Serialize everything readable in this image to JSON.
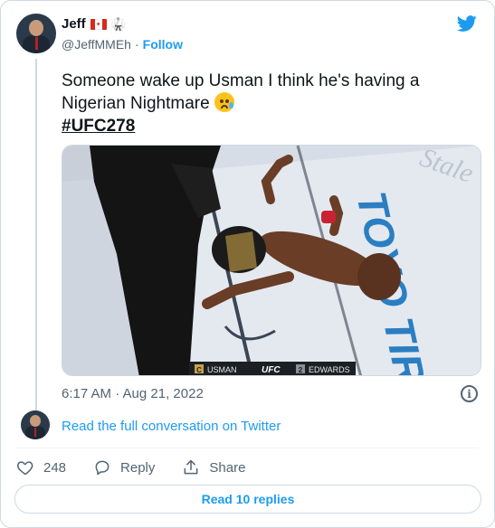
{
  "author": {
    "name": "Jeff",
    "handle": "@JeffMMEh",
    "separator": "·",
    "follow_label": "Follow",
    "flag_icon": "canada-flag-icon",
    "badge_icon": "karate-gi-icon"
  },
  "tweet": {
    "text": "Someone wake up Usman I think he's having a Nigerian Nightmare",
    "emoji_icon": "crying-face-emoji",
    "hashtag": "#UFC278"
  },
  "media": {
    "scoreboard_left": "USMAN",
    "scoreboard_brand": "UFC",
    "scoreboard_right": "EDWARDS",
    "left_badge": "C",
    "right_badge": "2",
    "mat_text": "TOYO TIRES"
  },
  "meta": {
    "timestamp": "6:17 AM · Aug 21, 2022",
    "info_icon": "info-icon"
  },
  "conversation": {
    "link": "Read the full conversation on Twitter"
  },
  "actions": {
    "like_count": "248",
    "reply_label": "Reply",
    "share_label": "Share"
  },
  "replies_button": "Read 10 replies",
  "colors": {
    "accent": "#1d9bf0",
    "text": "#0f1419",
    "muted": "#536471",
    "border": "#cfd9de"
  }
}
